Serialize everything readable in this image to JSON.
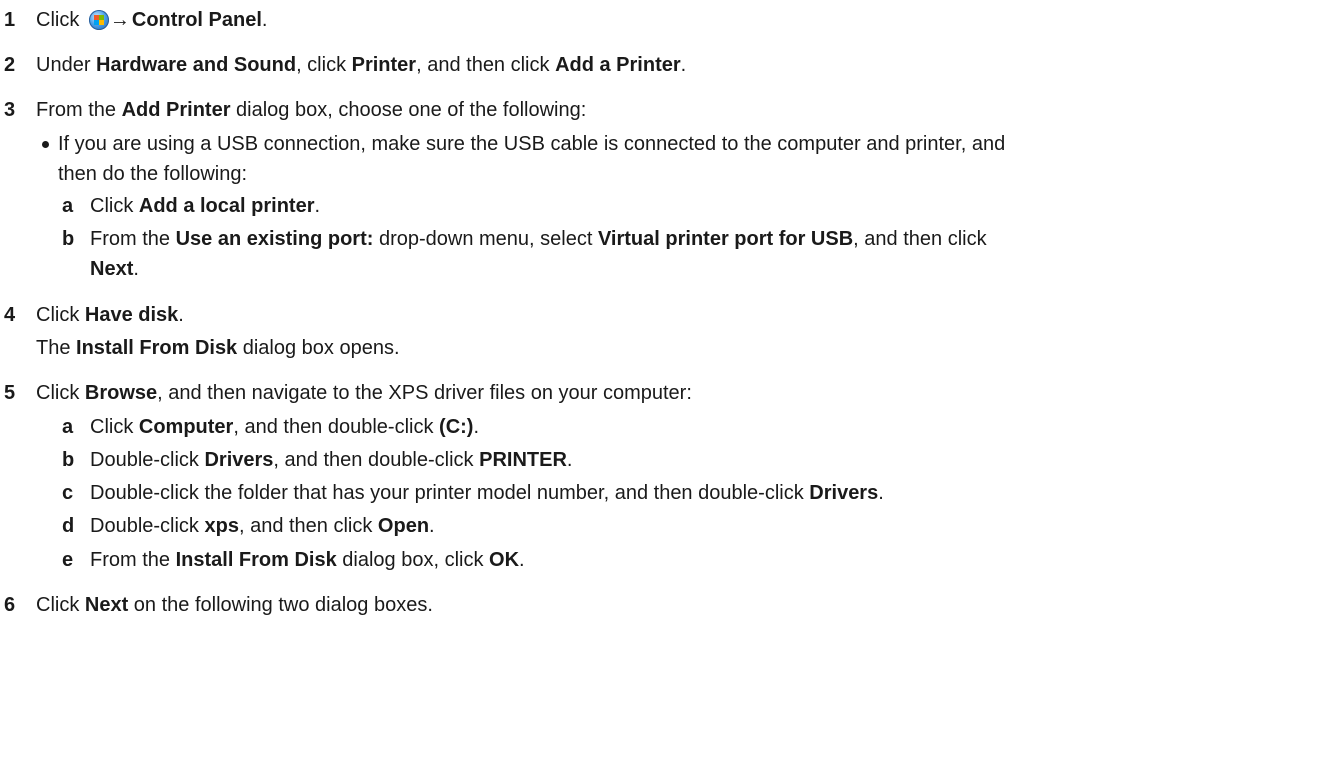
{
  "steps": [
    {
      "num": "1",
      "parts": [
        {
          "t": "Click ",
          "b": false
        },
        {
          "icon": "windows-start-icon"
        },
        {
          "t": "→ ",
          "b": true,
          "arrow": true
        },
        {
          "t": "Control Panel",
          "b": true
        },
        {
          "t": ".",
          "b": false
        }
      ]
    },
    {
      "num": "2",
      "parts": [
        {
          "t": "Under ",
          "b": false
        },
        {
          "t": "Hardware and Sound",
          "b": true
        },
        {
          "t": ", click ",
          "b": false
        },
        {
          "t": "Printer",
          "b": true
        },
        {
          "t": ", and then click ",
          "b": false
        },
        {
          "t": "Add a Printer",
          "b": true
        },
        {
          "t": ".",
          "b": false
        }
      ]
    },
    {
      "num": "3",
      "parts": [
        {
          "t": "From the ",
          "b": false
        },
        {
          "t": "Add Printer",
          "b": true
        },
        {
          "t": " dialog box, choose one of the following:",
          "b": false
        }
      ]
    },
    {
      "bullet": true,
      "parts": [
        {
          "t": "If you are using a USB connection, make sure the USB cable is connected to the computer and printer, and",
          "b": false
        }
      ]
    },
    {
      "cont": true,
      "parts": [
        {
          "t": "then do the following:",
          "b": false
        }
      ]
    },
    {
      "sub": "a",
      "parts": [
        {
          "t": "Click ",
          "b": false
        },
        {
          "t": "Add a local printer",
          "b": true
        },
        {
          "t": ".",
          "b": false
        }
      ]
    },
    {
      "sub": "b",
      "parts": [
        {
          "t": "From the ",
          "b": false
        },
        {
          "t": "Use an existing port:",
          "b": true
        },
        {
          "t": " drop-down menu, select ",
          "b": false
        },
        {
          "t": "Virtual printer port for USB",
          "b": true
        },
        {
          "t": ", and then click",
          "b": false
        }
      ]
    },
    {
      "subcont": true,
      "parts": [
        {
          "t": "Next",
          "b": true
        },
        {
          "t": ".",
          "b": false
        }
      ]
    },
    {
      "num": "4",
      "parts": [
        {
          "t": "Click ",
          "b": false
        },
        {
          "t": "Have disk",
          "b": true
        },
        {
          "t": ".",
          "b": false
        }
      ]
    },
    {
      "para": true,
      "parts": [
        {
          "t": "The ",
          "b": false
        },
        {
          "t": "Install From Disk",
          "b": true
        },
        {
          "t": " dialog box opens.",
          "b": false
        }
      ]
    },
    {
      "num": "5",
      "parts": [
        {
          "t": "Click ",
          "b": false
        },
        {
          "t": "Browse",
          "b": true
        },
        {
          "t": ", and then navigate to the XPS driver files on your computer:",
          "b": false
        }
      ]
    },
    {
      "sub": "a",
      "parts": [
        {
          "t": "Click ",
          "b": false
        },
        {
          "t": "Computer",
          "b": true
        },
        {
          "t": ", and then double-click ",
          "b": false
        },
        {
          "t": "(C:)",
          "b": true
        },
        {
          "t": ".",
          "b": false
        }
      ]
    },
    {
      "sub": "b",
      "parts": [
        {
          "t": "Double-click ",
          "b": false
        },
        {
          "t": "Drivers",
          "b": true
        },
        {
          "t": ", and then double-click ",
          "b": false
        },
        {
          "t": "PRINTER",
          "b": true
        },
        {
          "t": ".",
          "b": false
        }
      ]
    },
    {
      "sub": "c",
      "parts": [
        {
          "t": "Double-click the folder that has your printer model number, and then double-click ",
          "b": false
        },
        {
          "t": "Drivers",
          "b": true
        },
        {
          "t": ".",
          "b": false
        }
      ]
    },
    {
      "sub": "d",
      "parts": [
        {
          "t": "Double-click ",
          "b": false
        },
        {
          "t": "xps",
          "b": true
        },
        {
          "t": ", and then click ",
          "b": false
        },
        {
          "t": "Open",
          "b": true
        },
        {
          "t": ".",
          "b": false
        }
      ]
    },
    {
      "sub": "e",
      "parts": [
        {
          "t": "From the ",
          "b": false
        },
        {
          "t": "Install From Disk",
          "b": true
        },
        {
          "t": " dialog box, click ",
          "b": false
        },
        {
          "t": "OK",
          "b": true
        },
        {
          "t": ".",
          "b": false
        }
      ]
    },
    {
      "num": "6",
      "parts": [
        {
          "t": "Click ",
          "b": false
        },
        {
          "t": "Next",
          "b": true
        },
        {
          "t": " on the following two dialog boxes.",
          "b": false
        }
      ]
    }
  ]
}
